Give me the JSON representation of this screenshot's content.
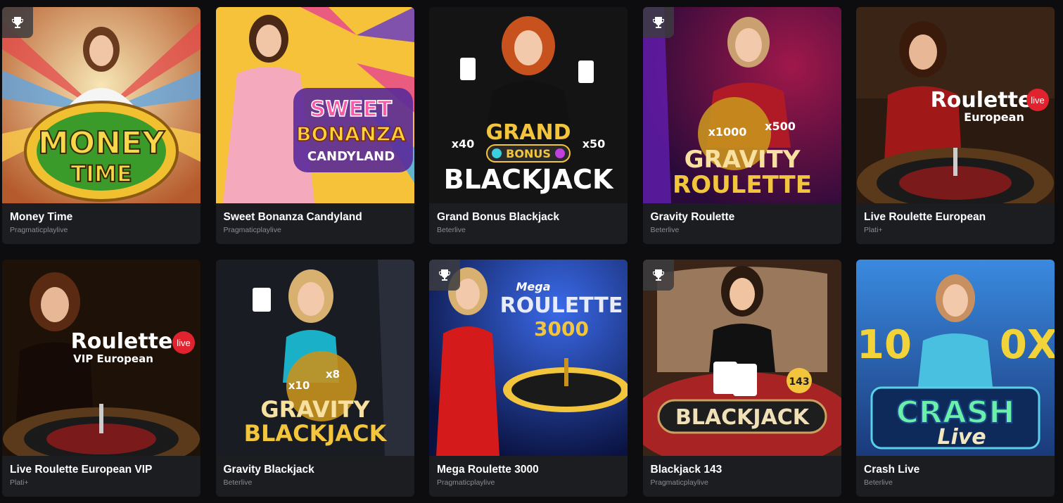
{
  "games": [
    {
      "title": "Money Time",
      "provider": "Pragmaticplaylive",
      "trophy": true,
      "logo": [
        "MONEY",
        "TIME"
      ]
    },
    {
      "title": "Sweet Bonanza Candyland",
      "provider": "Pragmaticplaylive",
      "trophy": false,
      "logo": [
        "SWEET",
        "BONANZA",
        "CANDYLAND"
      ]
    },
    {
      "title": "Grand Bonus Blackjack",
      "provider": "Beterlive",
      "trophy": false,
      "logo": [
        "GRAND",
        "BONUS",
        "BLACKJACK",
        "x40",
        "x50"
      ]
    },
    {
      "title": "Gravity Roulette",
      "provider": "Beterlive",
      "trophy": true,
      "logo": [
        "GRAVITY",
        "ROULETTE",
        "x1000",
        "x500"
      ]
    },
    {
      "title": "Live Roulette European",
      "provider": "Plati+",
      "trophy": false,
      "logo": [
        "Roulette",
        "live",
        "European"
      ]
    },
    {
      "title": "Live Roulette European VIP",
      "provider": "Plati+",
      "trophy": false,
      "logo": [
        "Roulette",
        "live",
        "VIP European"
      ]
    },
    {
      "title": "Gravity Blackjack",
      "provider": "Beterlive",
      "trophy": false,
      "logo": [
        "GRAVITY",
        "BLACKJACK",
        "x10",
        "x8"
      ]
    },
    {
      "title": "Mega Roulette 3000",
      "provider": "Pragmaticplaylive",
      "trophy": true,
      "logo": [
        "Mega",
        "ROULETTE",
        "3000"
      ]
    },
    {
      "title": "Blackjack 143",
      "provider": "Pragmaticplaylive",
      "trophy": true,
      "logo": [
        "BLACKJACK",
        "143"
      ]
    },
    {
      "title": "Crash Live",
      "provider": "Beterlive",
      "trophy": false,
      "logo": [
        "CRASH",
        "Live",
        "10",
        "0X"
      ]
    }
  ],
  "colors": {
    "card_bg": "#1c1d21",
    "page_bg": "#0d0d0f",
    "title": "#ffffff",
    "provider": "#8a8c93",
    "gold": "#f2c53d",
    "live_badge": "#e0232e"
  },
  "icons": {
    "trophy": "trophy-icon"
  }
}
